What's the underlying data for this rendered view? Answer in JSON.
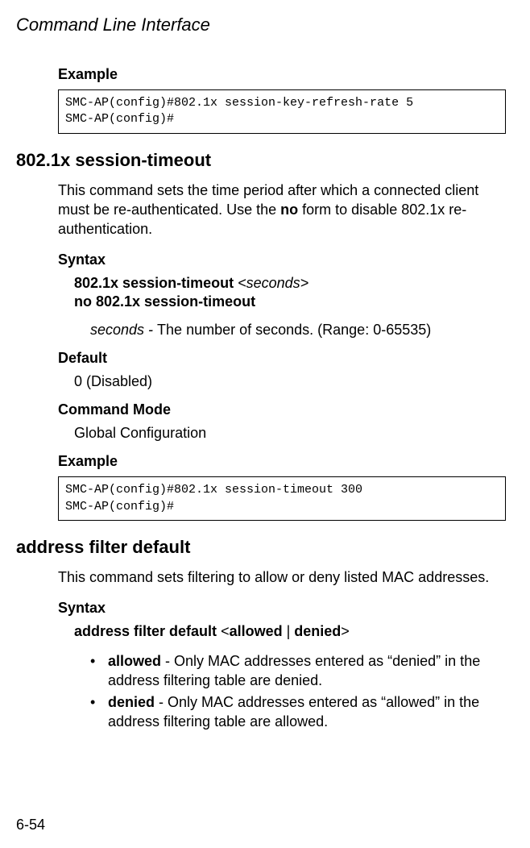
{
  "chapter_title": "Command Line Interface",
  "sec1": {
    "example_label": "Example",
    "code": "SMC-AP(config)#802.1x session-key-refresh-rate 5\nSMC-AP(config)#"
  },
  "cmd1": {
    "heading": "802.1x session-timeout",
    "desc_pre": "This command sets the time period after which a connected client must be re-authenticated. Use the ",
    "desc_bold": "no",
    "desc_post": " form to disable 802.1x re-authentication.",
    "syntax_label": "Syntax",
    "syntax_line1_bold": "802.1x session-timeout ",
    "syntax_line1_ital": "<seconds>",
    "syntax_line2_bold": "no 802.1x session-timeout",
    "param_ital": "seconds - ",
    "param_rest": "The number of seconds. (Range: 0-65535)",
    "default_label": "Default",
    "default_value": "0 (Disabled)",
    "mode_label": "Command Mode",
    "mode_value": "Global Configuration",
    "example_label": "Example",
    "code": "SMC-AP(config)#802.1x session-timeout 300\nSMC-AP(config)#"
  },
  "cmd2": {
    "heading": "address filter default",
    "desc": "This command sets filtering to allow or deny listed MAC addresses.",
    "syntax_label": "Syntax",
    "syntax_bold1": "address filter default ",
    "syntax_plain1": "<",
    "syntax_bold2": "allowed ",
    "syntax_plain2": "| ",
    "syntax_bold3": "denied",
    "syntax_plain3": ">",
    "bullet_dot": "•",
    "b1_bold": "allowed",
    "b1_rest": " - Only MAC addresses entered as “denied” in the address filtering table are denied.",
    "b2_bold": "denied",
    "b2_rest": " - Only MAC addresses entered as “allowed” in the address filtering table are allowed."
  },
  "page_num": "6-54"
}
